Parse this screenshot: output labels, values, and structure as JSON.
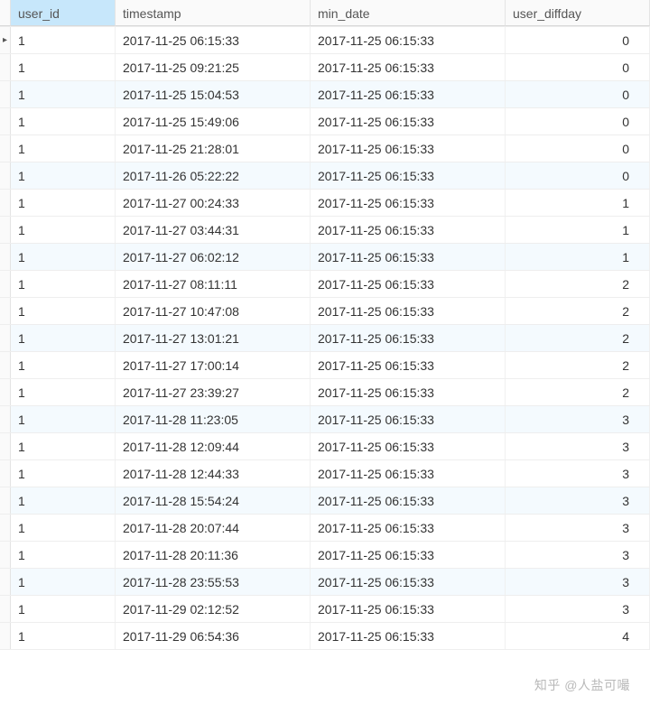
{
  "columns": {
    "user_id": "user_id",
    "timestamp": "timestamp",
    "min_date": "min_date",
    "user_diffday": "user_diffday"
  },
  "selected_column": "user_id",
  "min_date_value": "2017-11-25 06:15:33",
  "rows": [
    {
      "user_id": "1",
      "timestamp": "2017-11-25 06:15:33",
      "diff": "0",
      "cursor": true,
      "alt": false
    },
    {
      "user_id": "1",
      "timestamp": "2017-11-25 09:21:25",
      "diff": "0",
      "cursor": false,
      "alt": false
    },
    {
      "user_id": "1",
      "timestamp": "2017-11-25 15:04:53",
      "diff": "0",
      "cursor": false,
      "alt": true
    },
    {
      "user_id": "1",
      "timestamp": "2017-11-25 15:49:06",
      "diff": "0",
      "cursor": false,
      "alt": false
    },
    {
      "user_id": "1",
      "timestamp": "2017-11-25 21:28:01",
      "diff": "0",
      "cursor": false,
      "alt": false
    },
    {
      "user_id": "1",
      "timestamp": "2017-11-26 05:22:22",
      "diff": "0",
      "cursor": false,
      "alt": true
    },
    {
      "user_id": "1",
      "timestamp": "2017-11-27 00:24:33",
      "diff": "1",
      "cursor": false,
      "alt": false
    },
    {
      "user_id": "1",
      "timestamp": "2017-11-27 03:44:31",
      "diff": "1",
      "cursor": false,
      "alt": false
    },
    {
      "user_id": "1",
      "timestamp": "2017-11-27 06:02:12",
      "diff": "1",
      "cursor": false,
      "alt": true
    },
    {
      "user_id": "1",
      "timestamp": "2017-11-27 08:11:11",
      "diff": "2",
      "cursor": false,
      "alt": false
    },
    {
      "user_id": "1",
      "timestamp": "2017-11-27 10:47:08",
      "diff": "2",
      "cursor": false,
      "alt": false
    },
    {
      "user_id": "1",
      "timestamp": "2017-11-27 13:01:21",
      "diff": "2",
      "cursor": false,
      "alt": true
    },
    {
      "user_id": "1",
      "timestamp": "2017-11-27 17:00:14",
      "diff": "2",
      "cursor": false,
      "alt": false
    },
    {
      "user_id": "1",
      "timestamp": "2017-11-27 23:39:27",
      "diff": "2",
      "cursor": false,
      "alt": false
    },
    {
      "user_id": "1",
      "timestamp": "2017-11-28 11:23:05",
      "diff": "3",
      "cursor": false,
      "alt": true
    },
    {
      "user_id": "1",
      "timestamp": "2017-11-28 12:09:44",
      "diff": "3",
      "cursor": false,
      "alt": false
    },
    {
      "user_id": "1",
      "timestamp": "2017-11-28 12:44:33",
      "diff": "3",
      "cursor": false,
      "alt": false
    },
    {
      "user_id": "1",
      "timestamp": "2017-11-28 15:54:24",
      "diff": "3",
      "cursor": false,
      "alt": true
    },
    {
      "user_id": "1",
      "timestamp": "2017-11-28 20:07:44",
      "diff": "3",
      "cursor": false,
      "alt": false
    },
    {
      "user_id": "1",
      "timestamp": "2017-11-28 20:11:36",
      "diff": "3",
      "cursor": false,
      "alt": false
    },
    {
      "user_id": "1",
      "timestamp": "2017-11-28 23:55:53",
      "diff": "3",
      "cursor": false,
      "alt": true
    },
    {
      "user_id": "1",
      "timestamp": "2017-11-29 02:12:52",
      "diff": "3",
      "cursor": false,
      "alt": false
    },
    {
      "user_id": "1",
      "timestamp": "2017-11-29 06:54:36",
      "diff": "4",
      "cursor": false,
      "alt": false
    }
  ],
  "watermark": "知乎 @人盐可嘬"
}
